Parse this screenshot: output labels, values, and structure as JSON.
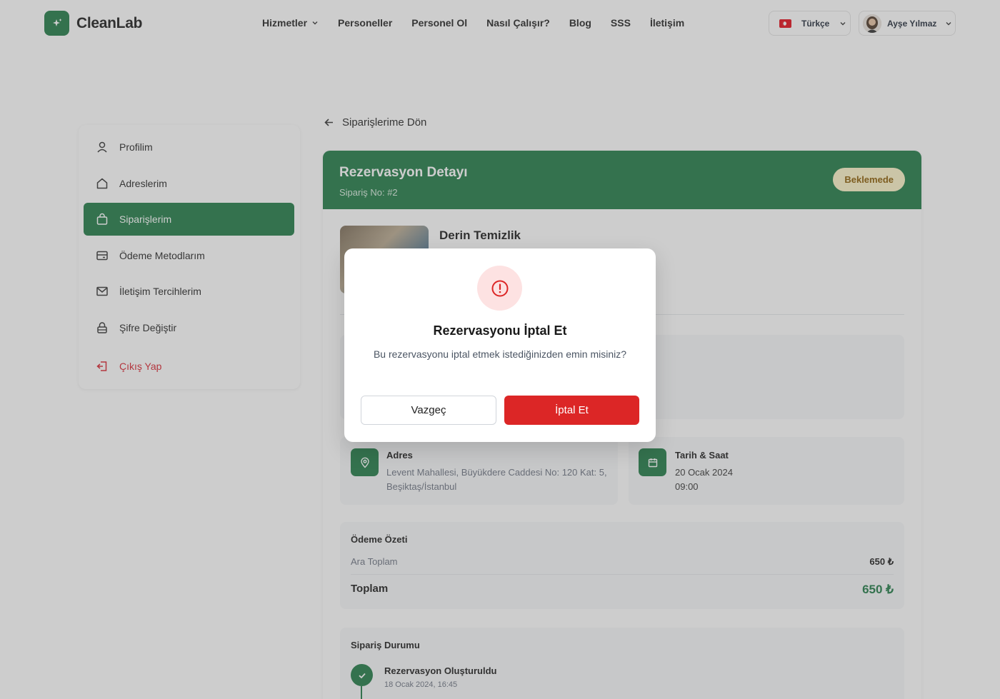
{
  "brand": {
    "name": "CleanLab",
    "color": "#1e7a45"
  },
  "nav": {
    "items": [
      {
        "label": "Hizmetler",
        "has_dropdown": true
      },
      {
        "label": "Personeller"
      },
      {
        "label": "Personel Ol"
      },
      {
        "label": "Nasıl Çalışır?"
      },
      {
        "label": "Blog"
      },
      {
        "label": "SSS"
      },
      {
        "label": "İletişim"
      }
    ]
  },
  "language": {
    "label": "Türkçe",
    "flag": "tr-flag-icon"
  },
  "user": {
    "name": "Ayşe Yılmaz"
  },
  "sidebar": {
    "items": [
      {
        "label": "Profilim",
        "icon": "user-icon"
      },
      {
        "label": "Adreslerim",
        "icon": "home-icon"
      },
      {
        "label": "Siparişlerim",
        "icon": "shopping-bag-icon",
        "active": true
      },
      {
        "label": "Ödeme Metodlarım",
        "icon": "credit-card-icon"
      },
      {
        "label": "İletişim Tercihlerim",
        "icon": "mail-icon"
      },
      {
        "label": "Şifre Değiştir",
        "icon": "lock-icon"
      },
      {
        "label": "Çıkış Yap",
        "icon": "logout-icon"
      }
    ]
  },
  "back_link": "Siparişlerime Dön",
  "reservation": {
    "title": "Rezervasyon Detayı",
    "order_no": "Sipariş No: #2",
    "status": "Beklemede",
    "service_name": "Derin Temizlik",
    "address_title": "Adres",
    "address_text": "Levent Mahallesi, Büyükdere Caddesi No: 120 Kat: 5, Beşiktaş/İstanbul",
    "datetime_title": "Tarih & Saat",
    "date": "20 Ocak 2024",
    "time": "09:00"
  },
  "payment": {
    "title": "Ödeme Özeti",
    "subtotal_label": "Ara Toplam",
    "subtotal_value": "650 ₺",
    "total_label": "Toplam",
    "total_value": "650 ₺"
  },
  "order_status": {
    "title": "Sipariş Durumu",
    "steps": [
      {
        "title": "Rezervasyon Oluşturuldu",
        "date": "18 Ocak 2024, 16:45"
      }
    ]
  },
  "modal": {
    "title": "Rezervasyonu İptal Et",
    "text": "Bu rezervasyonu iptal etmek istediğinizden emin misiniz?",
    "cancel_label": "Vazgeç",
    "confirm_label": "İptal Et",
    "icon": "alert-circle-icon"
  }
}
